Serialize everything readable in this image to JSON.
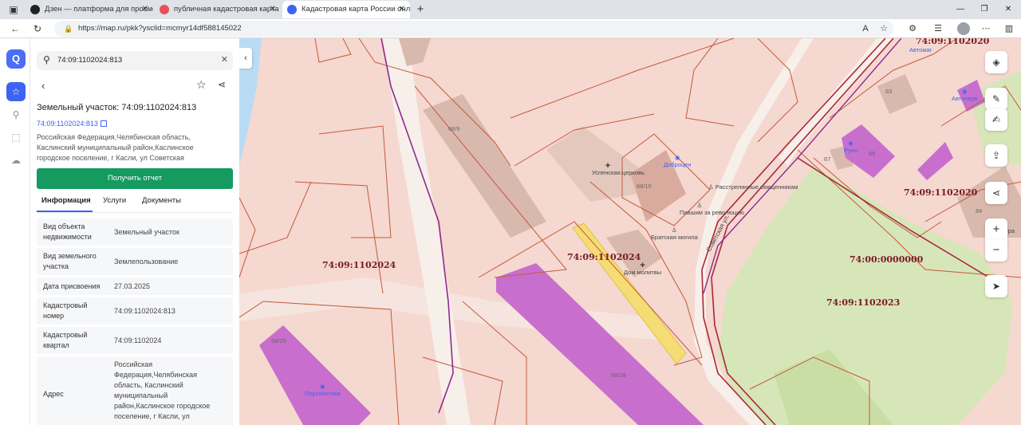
{
  "browser": {
    "tabs": [
      {
        "label": "Дзен — платформа для просмо",
        "active": false,
        "fav_color": "#222"
      },
      {
        "label": "публичная кадастровая карта —",
        "active": false,
        "fav_color": "#e8505b"
      },
      {
        "label": "Кадастровая карта России онла",
        "active": true,
        "fav_color": "#3d63f5"
      }
    ],
    "url": "https://map.ru/pkk?ysclid=mcmyr14df588145022",
    "read_aloud": "A"
  },
  "app": {
    "logo": "Q"
  },
  "panel": {
    "search_value": "74:09:1102024:813",
    "title": "Земельный участок: 74:09:1102024:813",
    "cad_link": "74:09:1102024:813",
    "address_desc": "Российская Федерация,Челябинская область, Каслинский муниципальный район,Каслинское городское поселение, г Касли, ул Советская",
    "report_button": "Получить отчет",
    "tabs": [
      "Информация",
      "Услуги",
      "Документы"
    ],
    "rows": [
      {
        "label": "Вид объекта недвижимости",
        "value": "Земельный участок"
      },
      {
        "label": "Вид земельного участка",
        "value": "Землепользование"
      },
      {
        "label": "Дата присвоения",
        "value": "27.03.2025"
      },
      {
        "label": "Кадастровый номер",
        "value": "74:09:1102024:813"
      },
      {
        "label": "Кадастровый квартал",
        "value": "74:09:1102024"
      },
      {
        "label": "Адрес",
        "value": "Российская Федерация,Челябинская область, Каслинский муниципальный район,Каслинское городское поселение, г Касли, ул"
      }
    ]
  },
  "map": {
    "labels": {
      "q_top": "74:09:1102020",
      "q_left": "74:09:1102024",
      "q_center": "74:09:1102024",
      "q_right": "74:09:1102020",
      "q_zero": "74:00:0000000",
      "q_2023": "74:09:1102023"
    },
    "pois": {
      "church": "Успенская церковь",
      "dobrocen": "Доброцен",
      "victims": "Расстрелянные священникам",
      "revolution": "Павшим за революцию",
      "grave": "Братская могила",
      "prayer": "Дом молитвы",
      "perspektiva": "Перспектива",
      "autoshop": "Автомаг",
      "autoservice": "Автосерв",
      "ruins": "Руин",
      "street": "Советская ул.",
      "cut_right": "ура"
    },
    "buildings": {
      "b68_9": "68/9",
      "b68_10": "68/10",
      "b68_28": "68/28",
      "b68_29": "68/29",
      "b63": "63",
      "b65": "65",
      "b67": "67",
      "b84": "84"
    }
  }
}
